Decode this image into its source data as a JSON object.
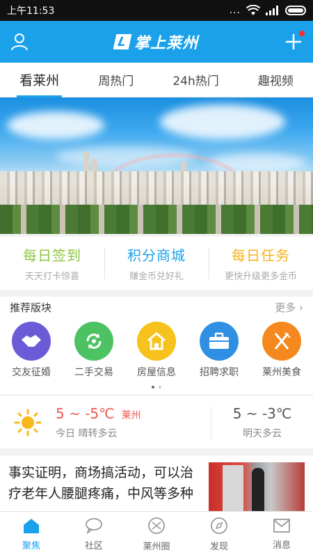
{
  "status_bar": {
    "time": "上午11:53",
    "dots": "..."
  },
  "header": {
    "logo_text": "掌上莱州",
    "logo_mark": "L"
  },
  "tabs": [
    {
      "label": "看莱州",
      "active": true
    },
    {
      "label": "周热门",
      "active": false
    },
    {
      "label": "24h热门",
      "active": false
    },
    {
      "label": "趣视频",
      "active": false
    }
  ],
  "quick_actions": [
    {
      "title": "每日签到",
      "subtitle": "天天打卡惊喜",
      "color": "#8cc63f"
    },
    {
      "title": "积分商城",
      "subtitle": "赚金币兑好礼",
      "color": "#1aa1ea"
    },
    {
      "title": "每日任务",
      "subtitle": "更快升级更多金币",
      "color": "#f6b21b"
    }
  ],
  "recommended": {
    "title": "推荐版块",
    "more": "更多",
    "items": [
      {
        "label": "交友征婚",
        "icon": "handshake-icon",
        "color": "#6b5bd6"
      },
      {
        "label": "二手交易",
        "icon": "recycle-icon",
        "color": "#4cc263"
      },
      {
        "label": "房屋信息",
        "icon": "house-icon",
        "color": "#f7c21b"
      },
      {
        "label": "招聘求职",
        "icon": "briefcase-icon",
        "color": "#2f8fe3"
      },
      {
        "label": "莱州美食",
        "icon": "fork-knife-icon",
        "color": "#f5881f"
      }
    ]
  },
  "weather": {
    "today_temp": "5 ~ -5℃",
    "city": "莱州",
    "today_desc": "今日 晴转多云",
    "tomorrow_temp": "5 ~ -3℃",
    "tomorrow_desc": "明天多云"
  },
  "news": {
    "title": "事实证明，商场搞活动，可以治疗老年人腰腿疼痛，中风等多种"
  },
  "bottom_nav": [
    {
      "label": "聚焦",
      "icon": "home-icon",
      "active": true
    },
    {
      "label": "社区",
      "icon": "chat-bubble-icon",
      "active": false
    },
    {
      "label": "莱州圈",
      "icon": "circle-icon",
      "active": false
    },
    {
      "label": "发现",
      "icon": "compass-icon",
      "active": false
    },
    {
      "label": "消息",
      "icon": "mail-icon",
      "active": false
    }
  ],
  "colors": {
    "accent": "#1aa1ea",
    "status_bar": "#111111",
    "weather_red": "#e95a4f"
  }
}
